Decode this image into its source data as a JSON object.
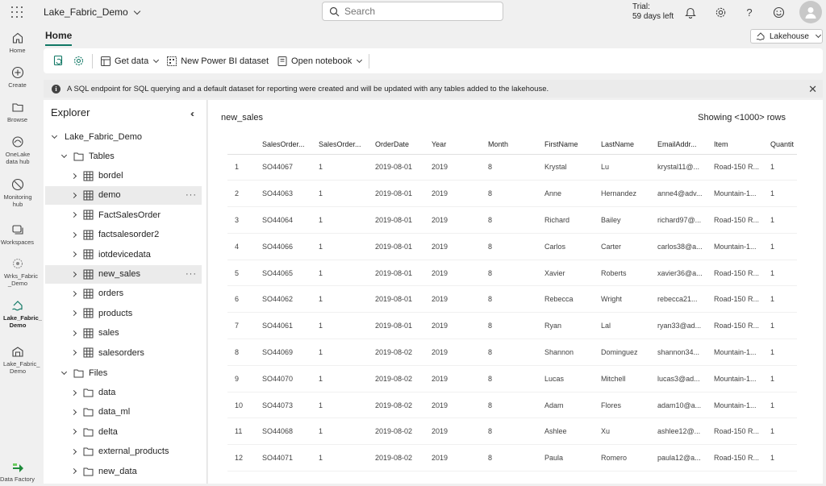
{
  "app": {
    "workspace_name": "Lake_Fabric_Demo",
    "search_placeholder": "Search",
    "trial_line1": "Trial:",
    "trial_line2": "59 days left"
  },
  "rail": {
    "items": [
      {
        "label": "Home",
        "icon": "home-icon"
      },
      {
        "label": "Create",
        "icon": "plus-circle-icon"
      },
      {
        "label": "Browse",
        "icon": "folder-icon"
      },
      {
        "label": "OneLake data hub",
        "icon": "onelake-icon"
      },
      {
        "label": "Monitoring hub",
        "icon": "monitor-icon"
      },
      {
        "label": "Workspaces",
        "icon": "workspaces-icon"
      },
      {
        "label": "Wrks_Fabric _Demo",
        "icon": "workspace-icon"
      },
      {
        "label": "Lake_Fabric_ Demo",
        "icon": "lakehouse-icon"
      },
      {
        "label": "Lake_Fabric_ Demo",
        "icon": "warehouse-icon"
      },
      {
        "label": "Data Factory",
        "icon": "data-factory-icon"
      }
    ]
  },
  "header": {
    "tab": "Home",
    "lakehouse_dropdown": "Lakehouse"
  },
  "toolbar": {
    "get_data": "Get data",
    "new_dataset": "New Power BI dataset",
    "open_notebook": "Open notebook"
  },
  "banner": {
    "message": "A SQL endpoint for SQL querying and a default dataset for reporting were created and will be updated with any tables added to the lakehouse."
  },
  "explorer": {
    "title": "Explorer",
    "root": "Lake_Fabric_Demo",
    "tables_label": "Tables",
    "tables": [
      "bordel",
      "demo",
      "FactSalesOrder",
      "factsalesorder2",
      "iotdevicedata",
      "new_sales",
      "orders",
      "products",
      "sales",
      "salesorders"
    ],
    "files_label": "Files",
    "files": [
      "data",
      "data_ml",
      "delta",
      "external_products",
      "new_data"
    ]
  },
  "preview": {
    "table_name": "new_sales",
    "showing": "Showing <1000> rows",
    "columns": [
      "",
      "SalesOrder...",
      "SalesOrder...",
      "OrderDate",
      "Year",
      "Month",
      "FirstName",
      "LastName",
      "EmailAddr...",
      "Item",
      "Quantit"
    ],
    "rows": [
      [
        "1",
        "SO44067",
        "1",
        "2019-08-01",
        "2019",
        "8",
        "Krystal",
        "Lu",
        "krystal11@...",
        "Road-150 R...",
        "1"
      ],
      [
        "2",
        "SO44063",
        "1",
        "2019-08-01",
        "2019",
        "8",
        "Anne",
        "Hernandez",
        "anne4@adv...",
        "Mountain-1...",
        "1"
      ],
      [
        "3",
        "SO44064",
        "1",
        "2019-08-01",
        "2019",
        "8",
        "Richard",
        "Bailey",
        "richard97@...",
        "Road-150 R...",
        "1"
      ],
      [
        "4",
        "SO44066",
        "1",
        "2019-08-01",
        "2019",
        "8",
        "Carlos",
        "Carter",
        "carlos38@a...",
        "Mountain-1...",
        "1"
      ],
      [
        "5",
        "SO44065",
        "1",
        "2019-08-01",
        "2019",
        "8",
        "Xavier",
        "Roberts",
        "xavier36@a...",
        "Road-150 R...",
        "1"
      ],
      [
        "6",
        "SO44062",
        "1",
        "2019-08-01",
        "2019",
        "8",
        "Rebecca",
        "Wright",
        "rebecca21...",
        "Road-150 R...",
        "1"
      ],
      [
        "7",
        "SO44061",
        "1",
        "2019-08-01",
        "2019",
        "8",
        "Ryan",
        "Lal",
        "ryan33@ad...",
        "Road-150 R...",
        "1"
      ],
      [
        "8",
        "SO44069",
        "1",
        "2019-08-02",
        "2019",
        "8",
        "Shannon",
        "Dominguez",
        "shannon34...",
        "Mountain-1...",
        "1"
      ],
      [
        "9",
        "SO44070",
        "1",
        "2019-08-02",
        "2019",
        "8",
        "Lucas",
        "Mitchell",
        "lucas3@ad...",
        "Mountain-1...",
        "1"
      ],
      [
        "10",
        "SO44073",
        "1",
        "2019-08-02",
        "2019",
        "8",
        "Adam",
        "Flores",
        "adam10@a...",
        "Mountain-1...",
        "1"
      ],
      [
        "11",
        "SO44068",
        "1",
        "2019-08-02",
        "2019",
        "8",
        "Ashlee",
        "Xu",
        "ashlee12@...",
        "Road-150 R...",
        "1"
      ],
      [
        "12",
        "SO44071",
        "1",
        "2019-08-02",
        "2019",
        "8",
        "Paula",
        "Romero",
        "paula12@a...",
        "Road-150 R...",
        "1"
      ]
    ]
  }
}
